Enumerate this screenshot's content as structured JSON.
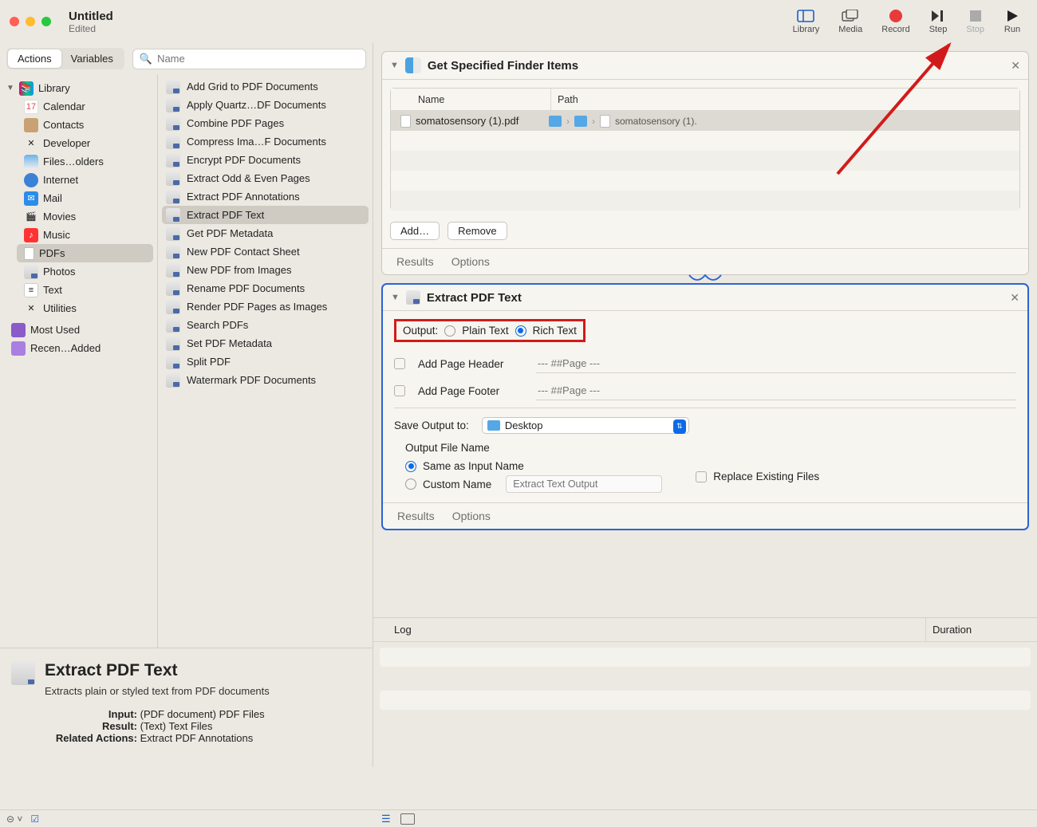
{
  "window": {
    "title": "Untitled",
    "subtitle": "Edited"
  },
  "toolbar": {
    "library": "Library",
    "media": "Media",
    "record": "Record",
    "step": "Step",
    "stop": "Stop",
    "run": "Run"
  },
  "tabs": {
    "actions": "Actions",
    "variables": "Variables"
  },
  "search": {
    "placeholder": "Name"
  },
  "library": {
    "header": "Library",
    "items": [
      {
        "label": "Calendar"
      },
      {
        "label": "Contacts"
      },
      {
        "label": "Developer"
      },
      {
        "label": "Files…olders"
      },
      {
        "label": "Internet"
      },
      {
        "label": "Mail"
      },
      {
        "label": "Movies"
      },
      {
        "label": "Music"
      },
      {
        "label": "PDFs",
        "selected": true
      },
      {
        "label": "Photos"
      },
      {
        "label": "Text"
      },
      {
        "label": "Utilities"
      }
    ],
    "footer": [
      {
        "label": "Most Used"
      },
      {
        "label": "Recen…Added"
      }
    ]
  },
  "actions": [
    "Add Grid to PDF Documents",
    "Apply Quartz…DF Documents",
    "Combine PDF Pages",
    "Compress Ima…F Documents",
    "Encrypt PDF Documents",
    "Extract Odd & Even Pages",
    "Extract PDF Annotations",
    "Extract PDF Text",
    "Get PDF Metadata",
    "New PDF Contact Sheet",
    "New PDF from Images",
    "Rename PDF Documents",
    "Render PDF Pages as Images",
    "Search PDFs",
    "Set PDF Metadata",
    "Split PDF",
    "Watermark PDF Documents"
  ],
  "actions_selected": 7,
  "info": {
    "title": "Extract PDF Text",
    "desc": "Extracts plain or styled text from PDF documents",
    "input_l": "Input:",
    "input_v": "(PDF document) PDF Files",
    "result_l": "Result:",
    "result_v": "(Text) Text Files",
    "related_l": "Related Actions:",
    "related_v": "Extract PDF Annotations"
  },
  "wf": {
    "finder": {
      "title": "Get Specified Finder Items",
      "col_name": "Name",
      "col_path": "Path",
      "file": "somatosensory (1).pdf",
      "crumb": "somatosensory (1).",
      "add": "Add…",
      "remove": "Remove",
      "results": "Results",
      "options": "Options"
    },
    "extract": {
      "title": "Extract PDF Text",
      "output_l": "Output:",
      "plain": "Plain Text",
      "rich": "Rich Text",
      "header_l": "Add Page Header",
      "header_ph": "--- ##Page ---",
      "footer_l": "Add Page Footer",
      "footer_ph": "--- ##Page ---",
      "save_l": "Save Output to:",
      "save_v": "Desktop",
      "ofn_title": "Output File Name",
      "same": "Same as Input Name",
      "custom": "Custom Name",
      "custom_ph": "Extract Text Output",
      "replace": "Replace Existing Files",
      "results": "Results",
      "options": "Options"
    }
  },
  "log": {
    "log": "Log",
    "duration": "Duration"
  }
}
